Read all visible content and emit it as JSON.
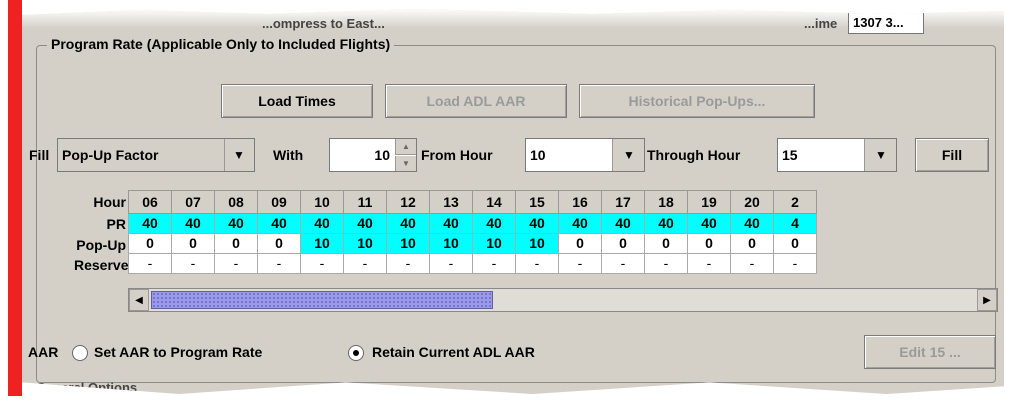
{
  "top": {
    "partial_label": "...ompress to East...",
    "time_label": "...ime",
    "time_value": "1307 3..."
  },
  "program_rate": {
    "legend": "Program Rate (Applicable Only to Included Flights)",
    "buttons": {
      "load_times": "Load Times",
      "load_adl_aar": "Load ADL AAR",
      "historical_popups": "Historical Pop-Ups..."
    },
    "fill": {
      "fill_label": "Fill",
      "type_value": "Pop-Up Factor",
      "with_label": "With",
      "with_value": "10",
      "from_hour_label": "From Hour",
      "from_hour_value": "10",
      "through_hour_label": "Through Hour",
      "through_hour_value": "15",
      "fill_button": "Fill"
    },
    "grid": {
      "row_labels": [
        "Hour",
        "PR",
        "Pop-Up",
        "Reserve"
      ],
      "hours": [
        "06",
        "07",
        "08",
        "09",
        "10",
        "11",
        "12",
        "13",
        "14",
        "15",
        "16",
        "17",
        "18",
        "19",
        "20",
        "2"
      ],
      "pr": [
        "40",
        "40",
        "40",
        "40",
        "40",
        "40",
        "40",
        "40",
        "40",
        "40",
        "40",
        "40",
        "40",
        "40",
        "40",
        "4"
      ],
      "popup": [
        "0",
        "0",
        "0",
        "0",
        "10",
        "10",
        "10",
        "10",
        "10",
        "10",
        "0",
        "0",
        "0",
        "0",
        "0",
        "0"
      ],
      "reserve": [
        "-",
        "-",
        "-",
        "-",
        "-",
        "-",
        "-",
        "-",
        "-",
        "-",
        "-",
        "-",
        "-",
        "-",
        "-",
        "-"
      ]
    },
    "aar": {
      "label": "AAR",
      "option_set": "Set AAR to Program Rate",
      "option_retain": "Retain Current ADL AAR",
      "selected": "retain",
      "edit_button": "Edit 15 ..."
    }
  },
  "general_options": {
    "label": "General Options"
  },
  "colors": {
    "highlight": "#00ffff",
    "panel": "#d4d0c8",
    "redbar": "#ee2222"
  }
}
